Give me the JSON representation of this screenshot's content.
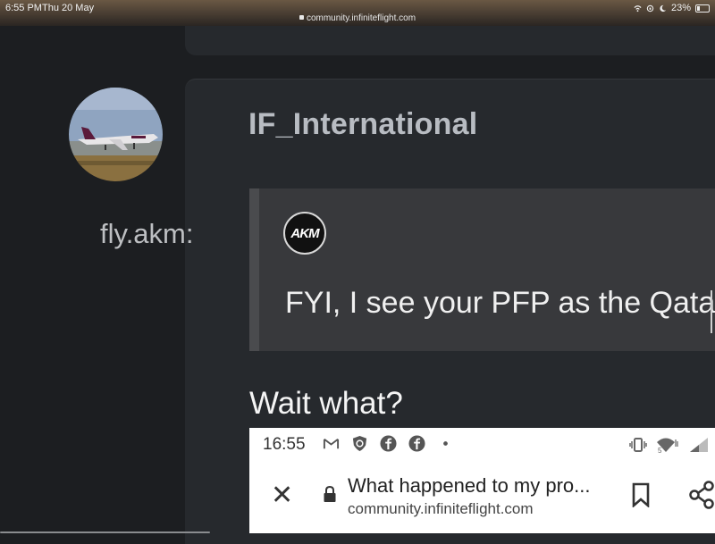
{
  "status_bar": {
    "time": "6:55 PM",
    "date": "Thu 20 May",
    "url": "community.infiniteflight.com",
    "battery": "23%"
  },
  "post": {
    "username": "IF_International",
    "quote": {
      "author": "fly.akm:",
      "avatar_text": "AKM",
      "text": "FYI, I see your PFP as the Qata"
    },
    "reply": "Wait what?"
  },
  "embedded_screenshot": {
    "time": "16:55",
    "page_title": "What happened to my pro...",
    "page_url": "community.infiniteflight.com",
    "notification_icons": [
      "gmail-icon",
      "shield-c-icon",
      "facebook-icon",
      "facebook-icon",
      "dot-icon"
    ],
    "system_icons": [
      "vibrate-icon",
      "wifi-icon",
      "signal-icon"
    ]
  },
  "colors": {
    "background": "#1c1e21",
    "card": "#26292d",
    "quote_bg": "#38393c",
    "username": "#b8bcc2"
  }
}
